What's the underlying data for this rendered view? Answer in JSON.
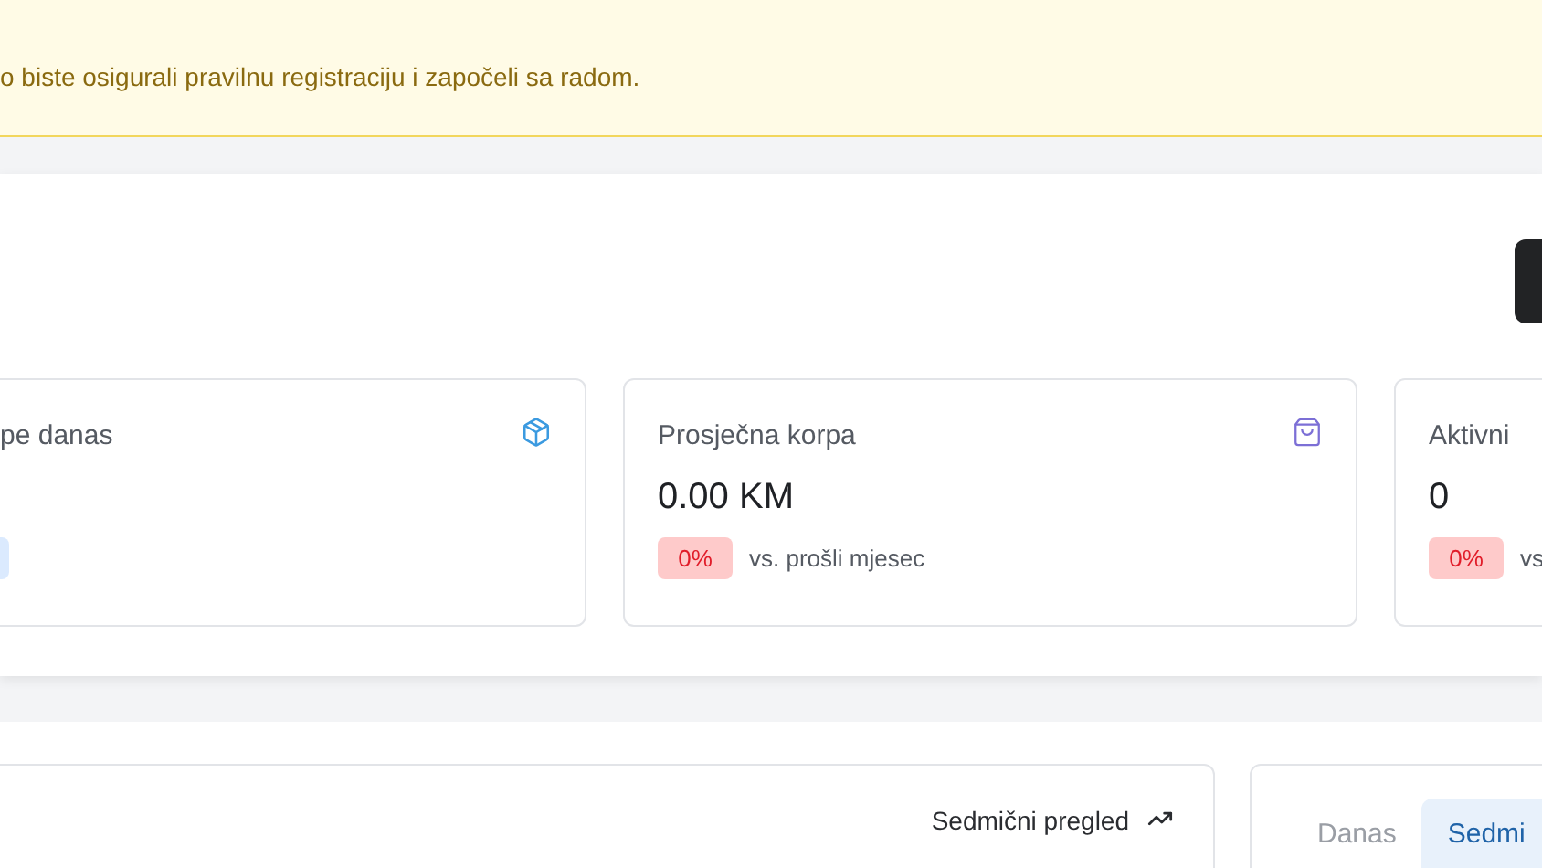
{
  "banner": {
    "text": "o biste osigurali pravilnu registraciju i započeli sa radom."
  },
  "stat_cards": [
    {
      "title": "pe danas",
      "badge": {
        "color": "#dbeafe"
      }
    },
    {
      "title": "Prosječna korpa",
      "value": "0.00 KM",
      "badge": {
        "text": "0%",
        "color": "#fecaca"
      },
      "note": "vs. prošli mjesec"
    },
    {
      "title": "Aktivni",
      "value": "0",
      "badge": {
        "text": "0%",
        "color": "#fecaca"
      },
      "note": "vs"
    }
  ],
  "chart_card": {
    "label": "Sedmični pregled"
  },
  "period_tabs": [
    {
      "label": "Danas",
      "selected": false
    },
    {
      "label": "Sedmi",
      "selected": true
    }
  ]
}
